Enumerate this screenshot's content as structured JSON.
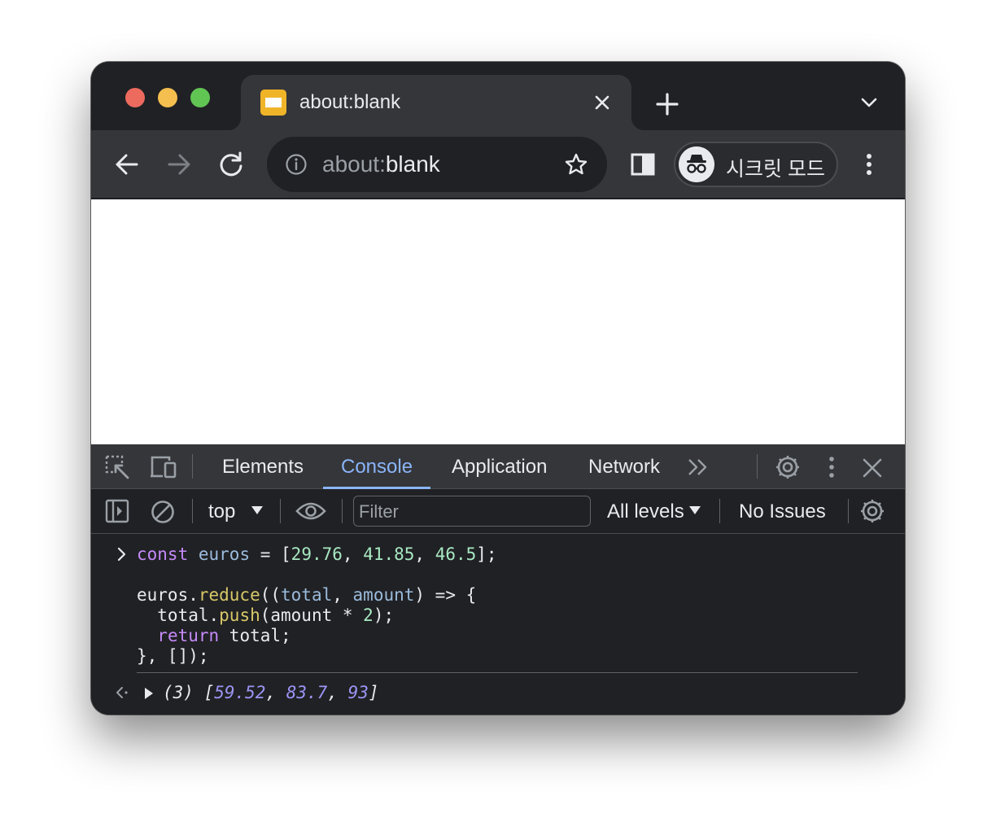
{
  "browser": {
    "tab": {
      "title": "about:blank"
    },
    "omnibox": {
      "url_dim": "about:",
      "url_main": "blank"
    },
    "profile": {
      "label": "시크릿 모드"
    }
  },
  "devtools": {
    "tabs": [
      {
        "label": "Elements"
      },
      {
        "label": "Console"
      },
      {
        "label": "Application"
      },
      {
        "label": "Network"
      }
    ],
    "active_tab": "Console",
    "console_toolbar": {
      "context": "top",
      "filter_placeholder": "Filter",
      "levels": "All levels",
      "issues": "No Issues"
    },
    "console": {
      "input_lines": [
        "const euros = [29.76, 41.85, 46.5];",
        "",
        "euros.reduce((total, amount) => {",
        "  total.push(amount * 2);",
        "  return total;",
        "}, []);"
      ],
      "result": {
        "length_label": "(3)",
        "values": [
          "59.52",
          "83.7",
          "93"
        ]
      }
    }
  },
  "colors": {
    "traffic_red": "#ed6a5e",
    "traffic_yellow": "#f5bf4f",
    "traffic_green": "#61c554",
    "accent_blue": "#8ab4f8",
    "syntax_keyword": "#c58af9",
    "syntax_variable": "#9bbbdc",
    "syntax_number": "#a8e8c3",
    "syntax_function": "#d7c869",
    "result_number": "#9c95f5"
  },
  "icons": [
    "back-arrow-icon",
    "forward-arrow-icon",
    "reload-icon",
    "info-icon",
    "star-icon",
    "side-panel-icon",
    "incognito-icon",
    "kebab-menu-icon",
    "close-icon",
    "plus-icon",
    "chevron-down-icon",
    "inspect-element-icon",
    "device-toolbar-icon",
    "more-tabs-chevrons-icon",
    "gear-icon",
    "sidebar-toggle-icon",
    "clear-console-icon",
    "eye-icon",
    "dropdown-triangle-icon",
    "prompt-chevron-icon",
    "result-arrow-icon",
    "expand-triangle-icon"
  ]
}
